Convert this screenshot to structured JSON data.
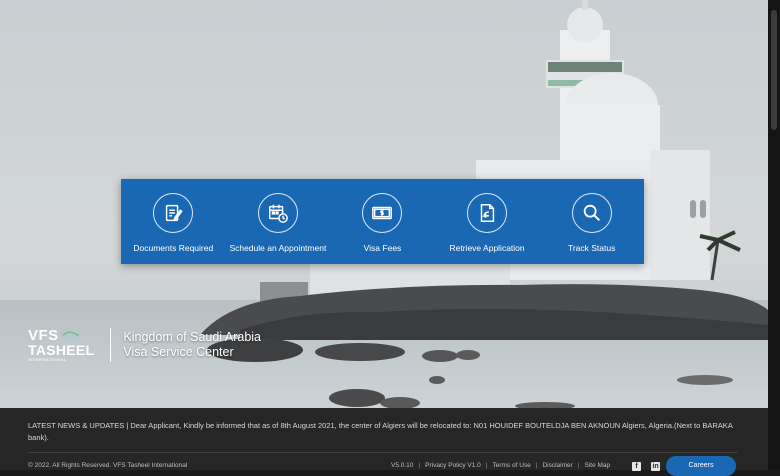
{
  "menu": {
    "items": [
      {
        "label": "Documents Required",
        "icon": "document-edit-icon"
      },
      {
        "label": "Schedule an Appointment",
        "icon": "calendar-clock-icon"
      },
      {
        "label": "Visa Fees",
        "icon": "money-icon"
      },
      {
        "label": "Retrieve Application",
        "icon": "retrieve-document-icon"
      },
      {
        "label": "Track Status",
        "icon": "search-icon"
      }
    ]
  },
  "brand": {
    "logo_line1": "VFS",
    "logo_line2": "TASHEEL",
    "logo_small": "INTERNATIONAL",
    "title_line1": "Kingdom of Saudi Arabia",
    "title_line2": "Visa Service Center"
  },
  "footer": {
    "news": "LATEST NEWS & UPDATES | Dear Applicant, Kindly be informed that as of 8th August 2021, the center of Algiers will be relocated to: N01 HOUIDEF BOUTELDJA BEN AKNOUN Algiers, Algeria.(Next to BARAKA bank).",
    "copyright": "© 2022. All Rights Reserved. VFS Tasheel International",
    "version": "V5.0.10",
    "links": [
      "Privacy Policy V1.0",
      "Terms of Use",
      "Disclaimer",
      "Site Map"
    ],
    "facebook": "f",
    "linkedin": "in",
    "careers": "Careers"
  },
  "colors": {
    "menu_blue": "#1a68b3",
    "footer_bg": "#262626"
  }
}
